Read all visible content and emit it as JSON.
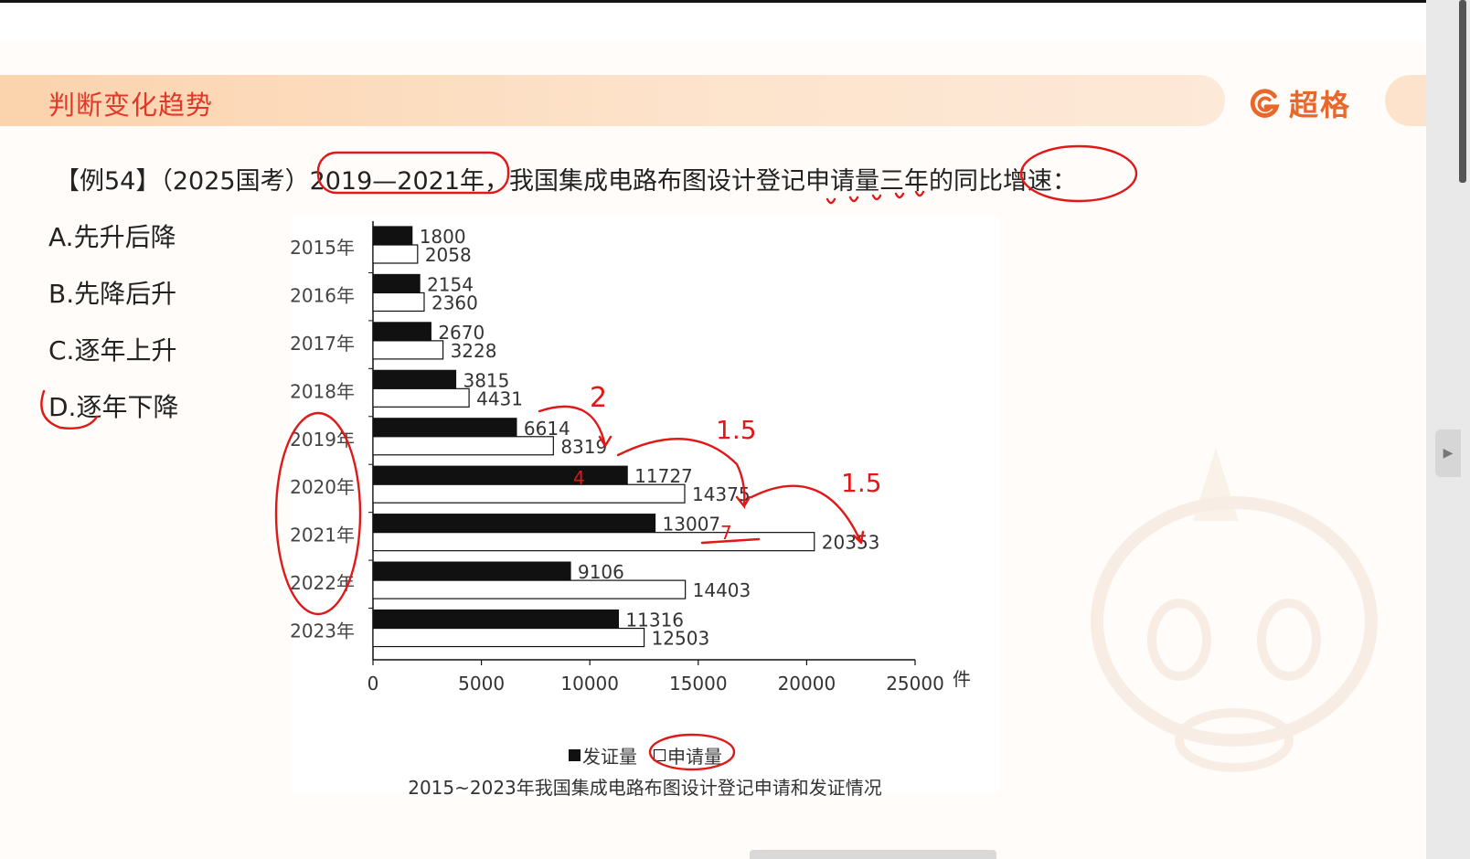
{
  "header": {
    "section_title": "判断变化趋势",
    "logo_text": "超格"
  },
  "question": {
    "text": "【例54】（2025国考）2019—2021年，我国集成电路布图设计登记申请量三年的同比增速："
  },
  "options": [
    {
      "label": "A.先升后降"
    },
    {
      "label": "B.先降后升"
    },
    {
      "label": "C.逐年上升"
    },
    {
      "label": "D.逐年下降"
    }
  ],
  "annotations": {
    "notes": [
      "2",
      "1.5",
      "1.5",
      "4",
      "7"
    ]
  },
  "chart_data": {
    "type": "bar",
    "orientation": "horizontal",
    "title": "2015~2023年我国集成电路布图设计登记申请和发证情况",
    "xlabel": "件",
    "xlim": [
      0,
      25000
    ],
    "xticks": [
      "0",
      "5000",
      "10000",
      "15000",
      "20000",
      "25000"
    ],
    "categories": [
      "2015年",
      "2016年",
      "2017年",
      "2018年",
      "2019年",
      "2020年",
      "2021年",
      "2022年",
      "2023年"
    ],
    "series": [
      {
        "name": "发证量",
        "color": "#111111",
        "values": [
          1800,
          2154,
          2670,
          3815,
          6614,
          11727,
          13007,
          9106,
          11316
        ]
      },
      {
        "name": "申请量",
        "color": "#ffffff",
        "values": [
          2058,
          2360,
          3228,
          4431,
          8319,
          14375,
          20353,
          14403,
          12503
        ]
      }
    ],
    "legend_position": "bottom"
  }
}
